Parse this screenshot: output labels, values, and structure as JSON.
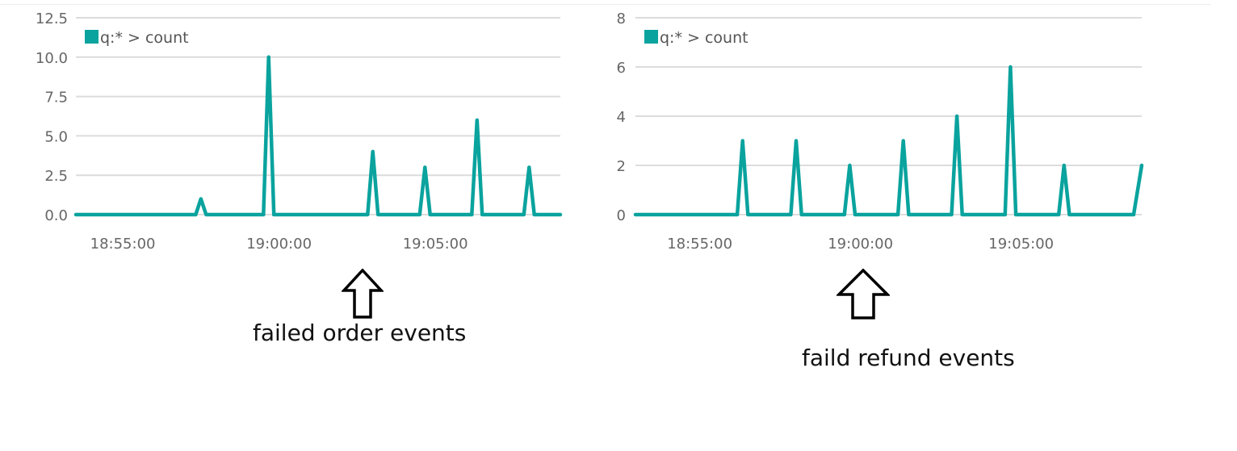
{
  "colors": {
    "series": "#0aa39e",
    "grid": "#dcdcdc",
    "tick_text": "#666666"
  },
  "annotations": [
    {
      "label": "failed order events",
      "icon": "up-arrow-icon"
    },
    {
      "label": "faild refund events",
      "icon": "up-arrow-icon"
    }
  ],
  "chart_data": [
    {
      "type": "line",
      "legend": "q:* > count",
      "legend_position": "top-left",
      "grid": true,
      "x_range": [
        "18:53:30",
        "19:09:00"
      ],
      "ylim": [
        0,
        12.5
      ],
      "y_ticks": [
        "0.0",
        "2.5",
        "5.0",
        "7.5",
        "10.0",
        "12.5"
      ],
      "y_tick_values": [
        0,
        2.5,
        5,
        7.5,
        10,
        12.5
      ],
      "x_ticks": [
        "18:55:00",
        "19:00:00",
        "19:05:00"
      ],
      "x_tick_values": [
        "18:55:00",
        "19:00:00",
        "19:05:00"
      ],
      "series": [
        {
          "color": "#0aa39e",
          "points": [
            [
              "18:53:30",
              0
            ],
            [
              "18:57:20",
              0
            ],
            [
              "18:57:30",
              1
            ],
            [
              "18:57:40",
              0
            ],
            [
              "18:59:30",
              0
            ],
            [
              "18:59:40",
              10
            ],
            [
              "18:59:50",
              0
            ],
            [
              "19:02:50",
              0
            ],
            [
              "19:03:00",
              4
            ],
            [
              "19:03:10",
              0
            ],
            [
              "19:04:30",
              0
            ],
            [
              "19:04:40",
              3
            ],
            [
              "19:04:50",
              0
            ],
            [
              "19:06:10",
              0
            ],
            [
              "19:06:20",
              6
            ],
            [
              "19:06:30",
              0
            ],
            [
              "19:07:50",
              0
            ],
            [
              "19:08:00",
              3
            ],
            [
              "19:08:10",
              0
            ],
            [
              "19:09:00",
              0
            ]
          ]
        }
      ]
    },
    {
      "type": "line",
      "legend": "q:* > count",
      "legend_position": "top-left",
      "grid": true,
      "x_range": [
        "18:53:00",
        "19:08:45"
      ],
      "ylim": [
        0,
        8
      ],
      "y_ticks": [
        "0",
        "2",
        "4",
        "6",
        "8"
      ],
      "y_tick_values": [
        0,
        2,
        4,
        6,
        8
      ],
      "x_ticks": [
        "18:55:00",
        "19:00:00",
        "19:05:00"
      ],
      "x_tick_values": [
        "18:55:00",
        "19:00:00",
        "19:05:00"
      ],
      "series": [
        {
          "color": "#0aa39e",
          "points": [
            [
              "18:53:00",
              0
            ],
            [
              "18:56:10",
              0
            ],
            [
              "18:56:20",
              3
            ],
            [
              "18:56:30",
              0
            ],
            [
              "18:57:50",
              0
            ],
            [
              "18:58:00",
              3
            ],
            [
              "18:58:10",
              0
            ],
            [
              "18:59:30",
              0
            ],
            [
              "18:59:40",
              2
            ],
            [
              "18:59:50",
              0
            ],
            [
              "19:01:10",
              0
            ],
            [
              "19:01:20",
              3
            ],
            [
              "19:01:30",
              0
            ],
            [
              "19:02:50",
              0
            ],
            [
              "19:03:00",
              4
            ],
            [
              "19:03:10",
              0
            ],
            [
              "19:04:30",
              0
            ],
            [
              "19:04:40",
              6
            ],
            [
              "19:04:50",
              0
            ],
            [
              "19:06:10",
              0
            ],
            [
              "19:06:20",
              2
            ],
            [
              "19:06:30",
              0
            ],
            [
              "19:08:30",
              0
            ],
            [
              "19:08:45",
              2
            ]
          ]
        }
      ]
    }
  ]
}
